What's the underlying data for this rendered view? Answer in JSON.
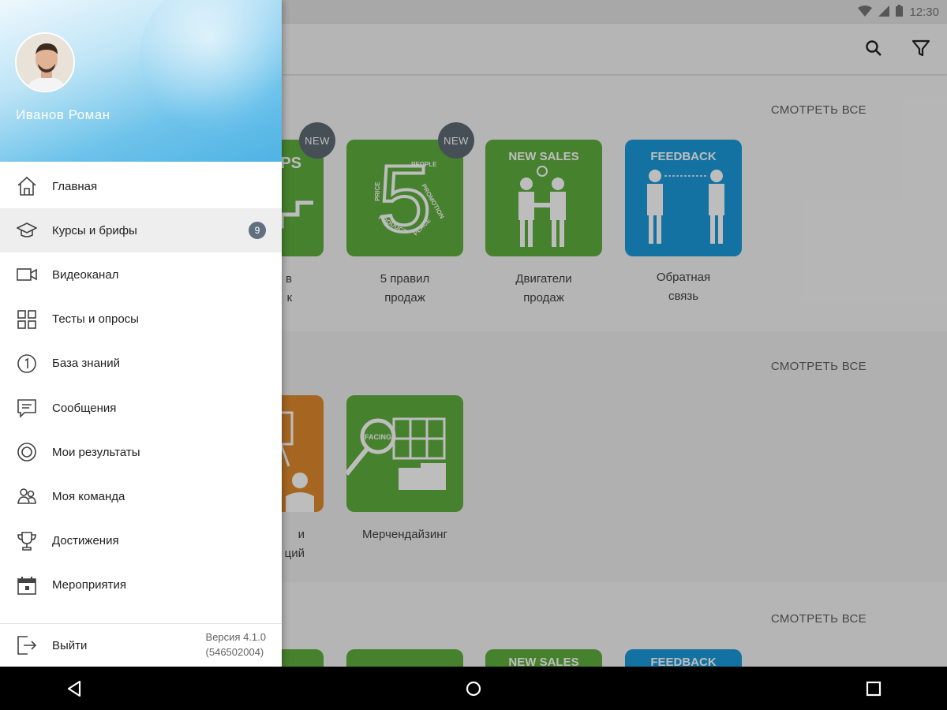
{
  "status_bar": {
    "time": "12:30"
  },
  "toolbar": {
    "search_icon": "search-icon",
    "filter_icon": "filter-icon"
  },
  "sections": [
    {
      "see_all": "СМОТРЕТЬ ВСЕ",
      "tiles": [
        {
          "banner": "STEPS",
          "caption_line1": "в",
          "caption_line2": "к",
          "badge": "NEW",
          "color": "#5fae3f"
        },
        {
          "banner": "5",
          "caption_line1": "5 правил",
          "caption_line2": "продаж",
          "badge": "NEW",
          "color": "#5fae3f",
          "words": [
            "PEOPLE",
            "PRICE",
            "PROMOTION",
            "PRODUCT",
            "PLACE"
          ]
        },
        {
          "banner": "NEW SALES",
          "caption_line1": "Двигатели",
          "caption_line2": "продаж",
          "color": "#5fae3f"
        },
        {
          "banner": "FEEDBACK",
          "caption_line1": "Обратная",
          "caption_line2": "связь",
          "color": "#1a9ad9"
        }
      ]
    },
    {
      "see_all": "СМОТРЕТЬ ВСЕ",
      "tiles": [
        {
          "caption_line1": "и",
          "caption_line2": "ций",
          "color": "#e08a2e"
        },
        {
          "banner": "FACING",
          "caption_line1": "Мерчендайзинг",
          "color": "#5fae3f"
        }
      ]
    },
    {
      "see_all": "СМОТРЕТЬ ВСЕ",
      "tiles": [
        {
          "color": "#5fae3f"
        },
        {
          "color": "#5fae3f"
        },
        {
          "banner": "NEW SALES",
          "color": "#5fae3f"
        },
        {
          "banner": "FEEDBACK",
          "color": "#1a9ad9"
        }
      ]
    }
  ],
  "drawer": {
    "user_name": "Иванов Роман",
    "items": [
      {
        "label": "Главная",
        "icon": "home-icon"
      },
      {
        "label": "Курсы и брифы",
        "icon": "graduation-cap-icon",
        "count": "9",
        "active": true
      },
      {
        "label": "Видеоканал",
        "icon": "video-camera-icon"
      },
      {
        "label": "Тесты и опросы",
        "icon": "grid-icon"
      },
      {
        "label": "База знаний",
        "icon": "info-circle-icon"
      },
      {
        "label": "Сообщения",
        "icon": "message-icon"
      },
      {
        "label": "Мои результаты",
        "icon": "target-icon"
      },
      {
        "label": "Моя команда",
        "icon": "team-icon"
      },
      {
        "label": "Достижения",
        "icon": "trophy-icon"
      },
      {
        "label": "Мероприятия",
        "icon": "calendar-icon"
      }
    ],
    "logout_label": "Выйти",
    "version_line1": "Версия 4.1.0",
    "version_line2": "(546502004)"
  },
  "nav_bar": {
    "back_icon": "back-icon",
    "home_icon": "home-circle-icon",
    "recents_icon": "recents-icon"
  }
}
